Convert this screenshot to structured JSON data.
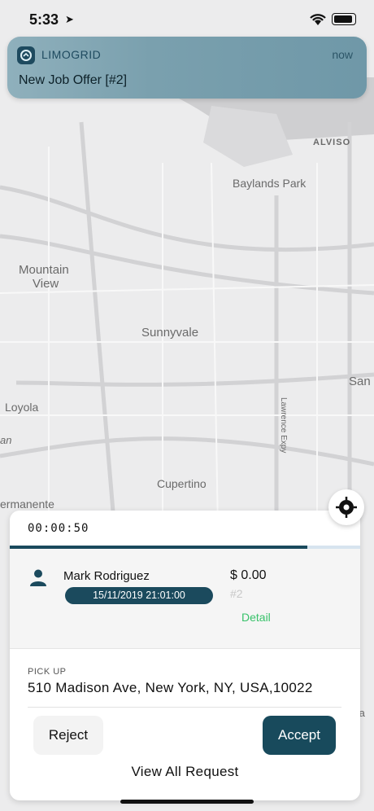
{
  "status_bar": {
    "time": "5:33",
    "location_glyph": "➤"
  },
  "notification": {
    "app": "LIMOGRID",
    "time": "now",
    "message": "New Job Offer [#2]"
  },
  "map": {
    "labels": [
      "ALVISO",
      "Baylands Park",
      "Mountain",
      "View",
      "Sunnyvale",
      "San",
      "Loyola",
      "Lawrence Expy",
      "Cupertino",
      "ermanente",
      "an",
      "ta"
    ]
  },
  "offer": {
    "timer": "00:00:50",
    "progress": 0.85,
    "customer_name": "Mark Rodriguez",
    "datetime": "15/11/2019 21:01:00",
    "price": "$ 0.00",
    "job_number": "#2",
    "detail_label": "Detail",
    "pickup_label": "PICK UP",
    "pickup_address": "510 Madison Ave, New York, NY, USA,10022",
    "reject_label": "Reject",
    "accept_label": "Accept",
    "view_all_label": "View All Request"
  }
}
